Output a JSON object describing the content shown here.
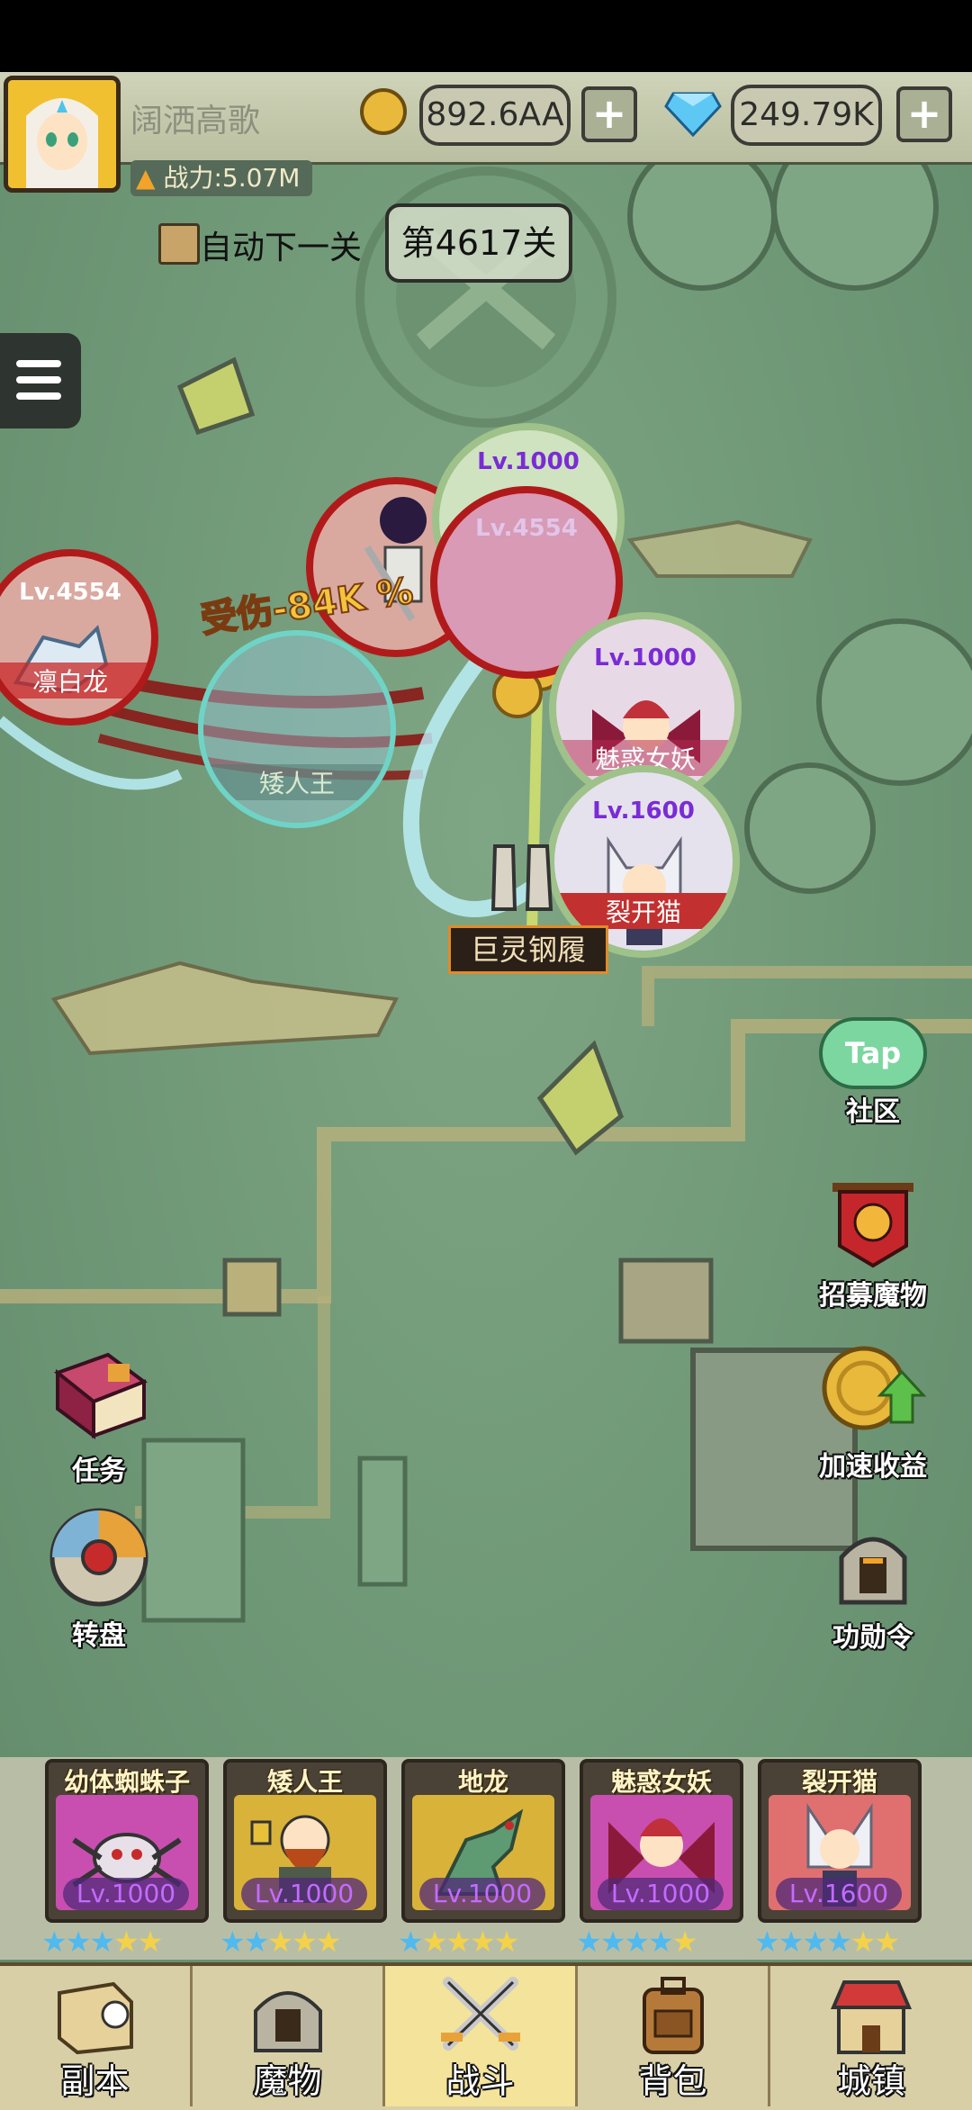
{
  "player": {
    "name": "阔洒高歌",
    "power": "战力:5.07M"
  },
  "currency": {
    "gold": "892.6AA",
    "diamonds": "249.79K",
    "plus": "+"
  },
  "stage": {
    "auto_next_label": "自动下一关",
    "level": "第4617关"
  },
  "battle": {
    "damage_text": "受伤-84K %",
    "item_drop": "巨灵钢履",
    "enemy": {
      "level": "Lv.4554",
      "name": "凛白龙"
    },
    "allies": [
      {
        "level": "Lv.1000",
        "name": "魅惑女妖"
      },
      {
        "level": "Lv.1600",
        "name": "裂开猫"
      },
      {
        "level": "Lv.1000",
        "name": ""
      },
      {
        "level": "Lv.4554",
        "name": ""
      },
      {
        "level": "",
        "name": "矮人王"
      }
    ]
  },
  "side_right": [
    {
      "label": "社区",
      "icon": "tap-cloud-icon",
      "icon_text": "Tap"
    },
    {
      "label": "招募魔物",
      "icon": "recruit-banner-icon"
    },
    {
      "label": "加速收益",
      "icon": "speed-income-coin-icon"
    },
    {
      "label": "功勋令",
      "icon": "helmet-icon"
    }
  ],
  "side_left": [
    {
      "label": "任务",
      "icon": "quest-book-icon"
    },
    {
      "label": "转盘",
      "icon": "spin-wheel-icon"
    }
  ],
  "team": [
    {
      "name": "幼体蜘蛛子",
      "level": "Lv.1000",
      "stars_blue": 3,
      "stars_gold": 2,
      "bg": "#c84fb0"
    },
    {
      "name": "矮人王",
      "level": "Lv.1000",
      "stars_blue": 2,
      "stars_gold": 3,
      "bg": "#d9b23a"
    },
    {
      "name": "地龙",
      "level": "Lv.1000",
      "stars_blue": 1,
      "stars_gold": 4,
      "bg": "#d9b23a"
    },
    {
      "name": "魅惑女妖",
      "level": "Lv.1000",
      "stars_blue": 4,
      "stars_gold": 1,
      "bg": "#c84fb0"
    },
    {
      "name": "裂开猫",
      "level": "Lv.1600",
      "stars_blue": 4,
      "stars_gold": 2,
      "bg": "#e07070"
    }
  ],
  "nav": [
    {
      "label": "副本",
      "icon": "map-scroll-icon",
      "active": false
    },
    {
      "label": "魔物",
      "icon": "monster-helmet-icon",
      "active": false
    },
    {
      "label": "战斗",
      "icon": "crossed-swords-icon",
      "active": true
    },
    {
      "label": "背包",
      "icon": "backpack-icon",
      "active": false
    },
    {
      "label": "城镇",
      "icon": "town-shop-icon",
      "active": false
    }
  ],
  "colors": {
    "map_bg": "#6f9877",
    "path": "#b9b07c",
    "accent_gold": "#f3d24a",
    "star_blue": "#4fb9f0"
  }
}
